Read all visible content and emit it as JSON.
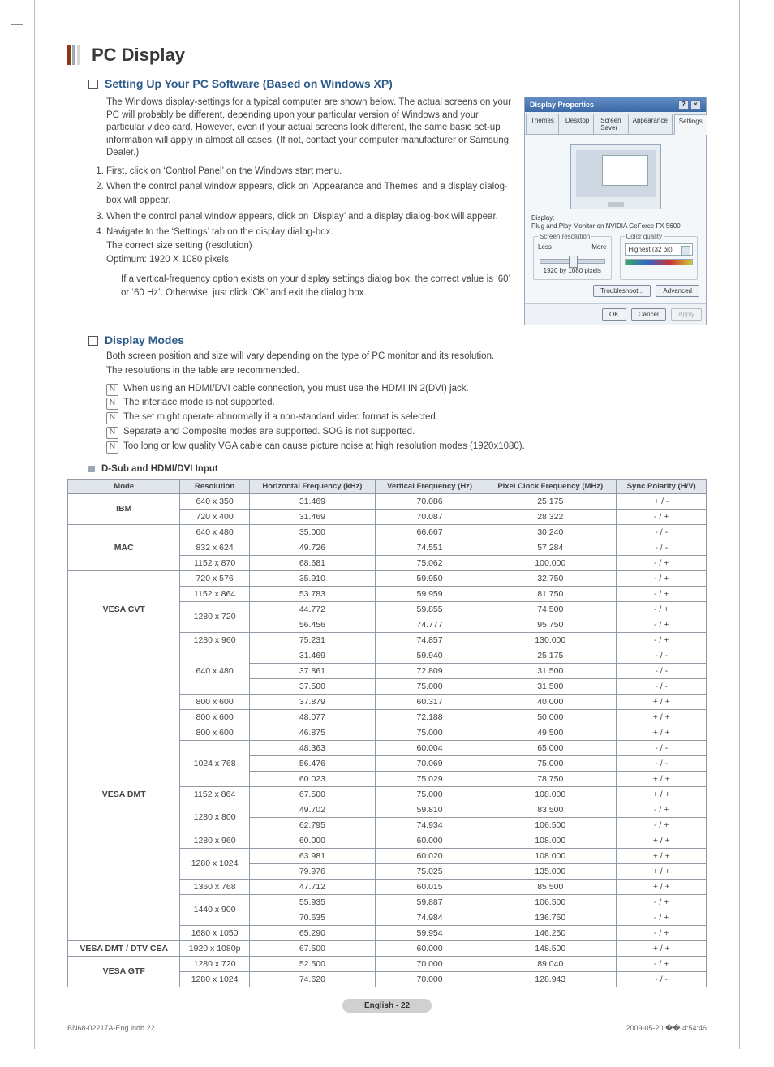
{
  "page_title": "PC Display",
  "sections": {
    "setup_title": "Setting Up Your PC Software (Based on Windows XP)",
    "display_modes_title": "Display Modes"
  },
  "intro": "The Windows display-settings for a typical computer are shown below. The actual screens on your PC will probably be different, depending upon your particular version of Windows and your particular video card. However, even if your actual screens look different, the same basic set-up information will apply in almost all cases. (If not, contact your computer manufacturer or Samsung Dealer.)",
  "steps": [
    "First, click on ‘Control Panel’ on the Windows start menu.",
    "When the control panel window appears, click on ‘Appearance and Themes’ and a display dialog-box will appear.",
    "When the control panel window appears, click on ‘Display’ and a display dialog-box will appear.",
    "Navigate to the ‘Settings’ tab on the display dialog-box."
  ],
  "step4_sub": [
    "The correct size setting (resolution)",
    "Optimum: 1920 X 1080 pixels"
  ],
  "step4_note": "If a vertical-frequency option exists on your display settings dialog box, the correct value is ‘60’ or ‘60 Hz’. Otherwise, just click ‘OK’ and exit the dialog box.",
  "display_modes_intro": [
    "Both screen position and size will vary depending on the type of PC monitor and its resolution.",
    "The resolutions in the table are recommended."
  ],
  "notes": [
    "When using an HDMI/DVI cable connection, you must use the HDMI IN 2(DVI) jack.",
    "The interlace mode is not supported.",
    "The set might operate abnormally if a non-standard video format is selected.",
    "Separate and Composite modes are supported. SOG is not supported.",
    "Too long or low quality VGA cable can cause picture noise at high resolution modes (1920x1080)."
  ],
  "table_title": "D-Sub and HDMI/DVI Input",
  "table_headers": [
    "Mode",
    "Resolution",
    "Horizontal Frequency (kHz)",
    "Vertical Frequency (Hz)",
    "Pixel Clock Frequency (MHz)",
    "Sync Polarity (H/V)"
  ],
  "table_groups": [
    {
      "mode": "IBM",
      "rows": [
        [
          "640 x 350",
          "31.469",
          "70.086",
          "25.175",
          "+ / -"
        ],
        [
          "720 x 400",
          "31.469",
          "70.087",
          "28.322",
          "- / +"
        ]
      ]
    },
    {
      "mode": "MAC",
      "rows": [
        [
          "640 x 480",
          "35.000",
          "66.667",
          "30.240",
          "- / -"
        ],
        [
          "832 x 624",
          "49.726",
          "74.551",
          "57.284",
          "- / -"
        ],
        [
          "1152 x 870",
          "68.681",
          "75.062",
          "100.000",
          "- / +"
        ]
      ]
    },
    {
      "mode": "VESA CVT",
      "rows_nested": [
        {
          "res": "720 x 576",
          "data": [
            [
              "35.910",
              "59.950",
              "32.750",
              "- / +"
            ]
          ]
        },
        {
          "res": "1152 x 864",
          "data": [
            [
              "53.783",
              "59.959",
              "81.750",
              "- / +"
            ]
          ]
        },
        {
          "res": "1280 x 720",
          "data": [
            [
              "44.772",
              "59.855",
              "74.500",
              "- / +"
            ],
            [
              "56.456",
              "74.777",
              "95.750",
              "- / +"
            ]
          ]
        },
        {
          "res": "1280 x 960",
          "data": [
            [
              "75.231",
              "74.857",
              "130.000",
              "- / +"
            ]
          ]
        }
      ]
    },
    {
      "mode": "VESA DMT",
      "rows_nested": [
        {
          "res": "640 x 480",
          "data": [
            [
              "31.469",
              "59.940",
              "25.175",
              "- / -"
            ],
            [
              "37.861",
              "72.809",
              "31.500",
              "- / -"
            ],
            [
              "37.500",
              "75.000",
              "31.500",
              "- / -"
            ]
          ]
        },
        {
          "res": "800 x 600",
          "data": [
            [
              "37.879",
              "60.317",
              "40.000",
              "+ / +"
            ]
          ]
        },
        {
          "res": "800 x 600",
          "data": [
            [
              "48.077",
              "72.188",
              "50.000",
              "+ / +"
            ]
          ]
        },
        {
          "res": "800 x 600",
          "data": [
            [
              "46.875",
              "75.000",
              "49.500",
              "+ / +"
            ]
          ]
        },
        {
          "res": "1024 x 768",
          "data": [
            [
              "48.363",
              "60.004",
              "65.000",
              "- / -"
            ],
            [
              "56.476",
              "70.069",
              "75.000",
              "- / -"
            ],
            [
              "60.023",
              "75.029",
              "78.750",
              "+ / +"
            ]
          ]
        },
        {
          "res": "1152 x 864",
          "data": [
            [
              "67.500",
              "75.000",
              "108.000",
              "+ / +"
            ]
          ]
        },
        {
          "res": "1280 x 800",
          "data": [
            [
              "49.702",
              "59.810",
              "83.500",
              "- / +"
            ],
            [
              "62.795",
              "74.934",
              "106.500",
              "- / +"
            ]
          ]
        },
        {
          "res": "1280 x 960",
          "data": [
            [
              "60.000",
              "60.000",
              "108.000",
              "+ / +"
            ]
          ]
        },
        {
          "res": "1280 x 1024",
          "data": [
            [
              "63.981",
              "60.020",
              "108.000",
              "+ / +"
            ],
            [
              "79.976",
              "75.025",
              "135.000",
              "+ / +"
            ]
          ]
        },
        {
          "res": "1360 x 768",
          "data": [
            [
              "47.712",
              "60.015",
              "85.500",
              "+ / +"
            ]
          ]
        },
        {
          "res": "1440 x 900",
          "data": [
            [
              "55.935",
              "59.887",
              "106.500",
              "- / +"
            ],
            [
              "70.635",
              "74.984",
              "136.750",
              "- / +"
            ]
          ]
        },
        {
          "res": "1680 x 1050",
          "data": [
            [
              "65.290",
              "59.954",
              "146.250",
              "- / +"
            ]
          ]
        }
      ]
    },
    {
      "mode": "VESA DMT / DTV CEA",
      "rows": [
        [
          "1920 x 1080p",
          "67.500",
          "60.000",
          "148.500",
          "+ / +"
        ]
      ]
    },
    {
      "mode": "VESA GTF",
      "rows": [
        [
          "1280 x 720",
          "52.500",
          "70.000",
          "89.040",
          "- / +"
        ],
        [
          "1280 x 1024",
          "74.620",
          "70.000",
          "128.943",
          "- / -"
        ]
      ]
    }
  ],
  "dlg": {
    "title": "Display Properties",
    "tabs": [
      "Themes",
      "Desktop",
      "Screen Saver",
      "Appearance",
      "Settings"
    ],
    "display_label": "Display:",
    "display_value": "Plug and Play Monitor on NVIDIA GeForce FX 5600",
    "screen_res": "Screen resolution",
    "less": "Less",
    "more": "More",
    "res_val": "1920 by 1080 pixels",
    "color": "Color quality",
    "color_val": "Highest (32 bit)",
    "troubleshoot": "Troubleshoot...",
    "advanced": "Advanced",
    "ok": "OK",
    "cancel": "Cancel",
    "apply": "Apply"
  },
  "page_label": "English - 22",
  "footer_left": "BN68-02217A-Eng.indb   22",
  "footer_right": "2009-05-20   �� 4:54:46"
}
